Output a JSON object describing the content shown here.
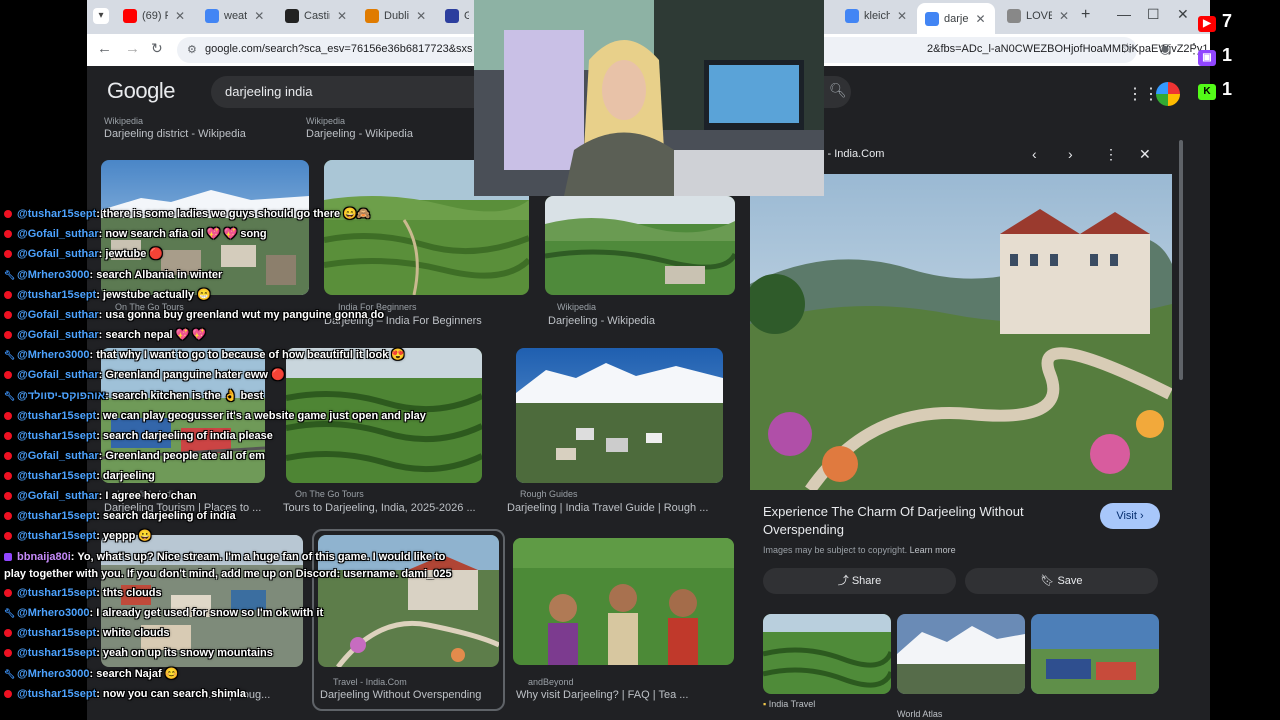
{
  "browser": {
    "tabs": [
      {
        "label": "(69) R",
        "fav": "youtube-icon",
        "color": "#ff0000"
      },
      {
        "label": "weat",
        "fav": "google-icon",
        "color": "#4285f4"
      },
      {
        "label": "Castir",
        "fav": "castr-icon",
        "color": "#222222"
      },
      {
        "label": "Dubli",
        "fav": "dublin-icon",
        "color": "#e07b00"
      },
      {
        "label": "Ga",
        "fav": "gamma-icon",
        "color": "#2c3e9e"
      },
      {
        "label": "kleich",
        "fav": "google-icon",
        "color": "#4285f4"
      },
      {
        "label": "darje",
        "fav": "google-icon",
        "color": "#4285f4"
      },
      {
        "label": "LOVE",
        "fav": "love-icon",
        "color": "#888888"
      }
    ],
    "url_left": "google.com/search?sca_esv=76156e36b6817723&sxs",
    "url_right": "2&fbs=ADc_l-aN0CWEZBOHjofHoaMMDiKpaEWjvZ2Py1..."
  },
  "google": {
    "logo": "Google",
    "query": "darjeeling india"
  },
  "results": {
    "top_row": [
      {
        "source": "Wikipedia",
        "caption": "Darjeeling district - Wikipedia"
      },
      {
        "source": "Wikipedia",
        "caption": "Darjeeling - Wikipedia"
      }
    ],
    "row1": [
      {
        "source": "On The Go Tours",
        "caption": ""
      },
      {
        "source": "India For Beginners",
        "caption": "Darjeeling – India For Beginners"
      },
      {
        "source": "Wikipedia",
        "caption": "Darjeeling - Wikipedia"
      }
    ],
    "row2": [
      {
        "source": "Incredible India",
        "caption": "Darjeeling Tourism | Places to ..."
      },
      {
        "source": "On The Go Tours",
        "caption": "Tours to Darjeeling, India, 2025-2026 ..."
      },
      {
        "source": "Rough Guides",
        "caption": "Darjeeling | India Travel Guide | Rough ..."
      }
    ],
    "row3": [
      {
        "source": "",
        "caption": "...ide | Roug..."
      },
      {
        "source": "Travel - India.Com",
        "caption": "Darjeeling Without Overspending"
      },
      {
        "source": "andBeyond",
        "caption": "Why visit Darjeeling? | FAQ | Tea ..."
      }
    ]
  },
  "panel": {
    "title": "l - India.Com",
    "headline": "Experience The Charm Of Darjeeling Without Overspending",
    "visit": "Visit",
    "copyright": "Images may be subject to copyright.",
    "learn_more": "Learn more",
    "share": "Share",
    "save": "Save",
    "related": [
      {
        "source": "India Travel"
      },
      {
        "source": "World Atlas"
      },
      {
        "source": ""
      }
    ]
  },
  "counters": [
    {
      "platform": "youtube-icon",
      "value": "7",
      "color": "#ff0000"
    },
    {
      "platform": "twitch-icon",
      "value": "1",
      "color": "#9146ff"
    },
    {
      "platform": "kick-icon",
      "value": "1",
      "color": "#53fc18"
    }
  ],
  "chat": [
    {
      "icon": "dot",
      "user": "@tushar15sept",
      "text": ": there is some ladies we guys should go there 😄🙈"
    },
    {
      "icon": "dot",
      "user": "@Gofail_suthar",
      "text": ": now search afia oil 💖 💖 song"
    },
    {
      "icon": "dot",
      "user": "@Gofail_suthar",
      "text": ": jewtube 🔴"
    },
    {
      "icon": "wrench",
      "user": "@Mrhero3000",
      "text": ": search Albania in winter"
    },
    {
      "icon": "dot",
      "user": "@tushar15sept",
      "text": ": jewstube actually 😁"
    },
    {
      "icon": "dot",
      "user": "@Gofail_suthar",
      "text": ": usa gonna buy greenland wut my panguine gonna do"
    },
    {
      "icon": "dot",
      "user": "@Gofail_suthar",
      "text": ": search nepal 💖 💖"
    },
    {
      "icon": "wrench",
      "user": "@Mrhero3000",
      "text": ": that why I want to go to because of how beautiful it look 😍"
    },
    {
      "icon": "dot",
      "user": "@Gofail_suthar",
      "text": ": Greenland panguine hater eww 🔴"
    },
    {
      "icon": "wrench",
      "user": "@אוהפוקס-יסוולד",
      "text": ": search kitchen is the 👌 best"
    },
    {
      "icon": "dot",
      "user": "@tushar15sept",
      "text": ": we can play geogusser it's a website game just open and play"
    },
    {
      "icon": "dot",
      "user": "@tushar15sept",
      "text": ": search darjeeling of india please"
    },
    {
      "icon": "dot",
      "user": "@Gofail_suthar",
      "text": ": Greenland people ate all of em"
    },
    {
      "icon": "dot",
      "user": "@tushar15sept",
      "text": ": darjeeling"
    },
    {
      "icon": "dot",
      "user": "@Gofail_suthar",
      "text": ": I agree hero chan"
    },
    {
      "icon": "dot",
      "user": "@tushar15sept",
      "text": ": search darjeeling of india"
    },
    {
      "icon": "dot",
      "user": "@tushar15sept",
      "text": ": yeppp 😀"
    },
    {
      "icon": "twitch",
      "user": "bbnaija80i",
      "text": ": Yo, what's up? Nice stream. I'm a huge fan of this game. I would like to"
    },
    {
      "icon": "none",
      "user": "",
      "text": "play together with you. If you don't mind, add me up on Discord: username. dami_025"
    },
    {
      "icon": "dot",
      "user": "@tushar15sept",
      "text": ": thts clouds"
    },
    {
      "icon": "wrench",
      "user": "@Mrhero3000",
      "text": ": I already get used for snow so I'm ok with it"
    },
    {
      "icon": "dot",
      "user": "@tushar15sept",
      "text": ": white clouds"
    },
    {
      "icon": "dot",
      "user": "@tushar15sept",
      "text": ": yeah on up its snowy mountains"
    },
    {
      "icon": "wrench",
      "user": "@Mrhero3000",
      "text": ": search Najaf 😊"
    },
    {
      "icon": "dot",
      "user": "@tushar15sept",
      "text": ": now you can search shimla"
    }
  ]
}
